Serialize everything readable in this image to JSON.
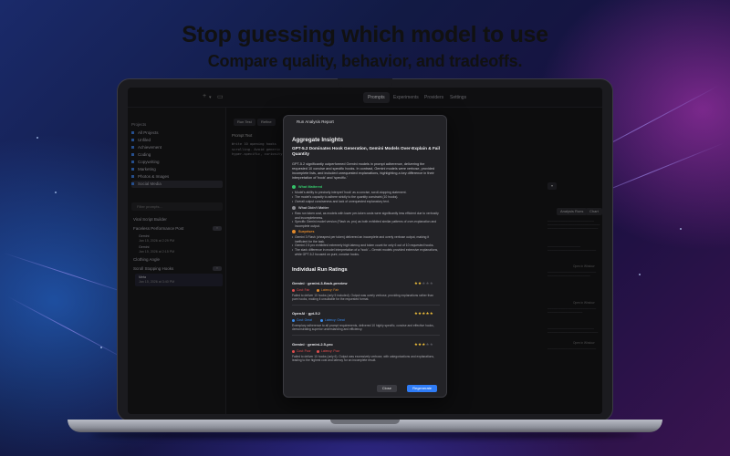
{
  "marketing": {
    "headline": "Stop guessing which model to use",
    "subheadline": "Compare quality, behavior, and tradeoffs."
  },
  "app": {
    "toolbar": {
      "add_icon": "plus-icon",
      "add_label": "+",
      "chevron_icon": "chevron-down-icon",
      "sidebar_toggle_icon": "sidebar-icon"
    },
    "tabs": [
      "Prompts",
      "Experiments",
      "Providers",
      "Settings"
    ],
    "active_tab": "Prompts",
    "sidebar": {
      "section_title": "Projects",
      "projects": [
        {
          "label": "All Projects",
          "count": ""
        },
        {
          "label": "Unfiled",
          "count": ""
        },
        {
          "label": "Achievement",
          "count": ""
        },
        {
          "label": "Coding",
          "count": ""
        },
        {
          "label": "Copywriting",
          "count": ""
        },
        {
          "label": "Marketing",
          "count": ""
        },
        {
          "label": "Photos & Images",
          "count": ""
        },
        {
          "label": "Social Media",
          "count": ""
        }
      ],
      "selected_project": "Social Media",
      "search_placeholder": "Filter prompts...",
      "groups": [
        {
          "label": "Viral Script Builder",
          "pill": ""
        },
        {
          "label": "Faceless Performance Post",
          "pill": ""
        },
        {
          "label": "Gemini",
          "sub": "Jan 15, 2026 at 2:29 PM"
        },
        {
          "label": "Gemini",
          "sub": "Jan 15, 2026 at 2:15 PM"
        },
        {
          "label": "Clothing Angle",
          "pill": ""
        },
        {
          "label": "Scroll Stopping Hooks",
          "pill": ""
        },
        {
          "label": "Meta",
          "sub": "Jan 15, 2026 at 3:40 PM"
        }
      ]
    },
    "editor": {
      "buttons": [
        "Run Test",
        "Refine"
      ],
      "section_label": "Prompt Text",
      "code_lines": [
        "Write 10 opening hooks",
        "scrolling. Avoid generic",
        "hyper-specific, curiosity"
      ]
    },
    "modal": {
      "window_title": "Run Analysis Report",
      "aggregate_title": "Aggregate Insights",
      "headline": "GPT-5.2 Dominates Hook Generation, Gemini Models Over-Explain & Fail Quantity",
      "summary": "GPT-5.2 significantly outperformed Gemini models in prompt adherence, delivering the requested 10 concise and specific hooks. In contrast, Gemini models were verbose, provided incomplete lists, and included unrequested explanations, highlighting a key difference in their interpretation of 'hook' and 'specific.'",
      "sections": [
        {
          "title": "What Mattered",
          "color": "#35c46a",
          "bullets": [
            "Model's ability to precisely interpret 'hook' as a concise, scroll-stopping statement.",
            "The model's capacity to adhere strictly to the quantity constraint (10 hooks).",
            "Overall output conciseness and lack of unrequested explanatory text."
          ]
        },
        {
          "title": "What Didn't Matter",
          "color": "#8a8a90",
          "bullets": [
            "Raw run token cost, as models with lower per-token costs were significantly less efficient due to verbosity and incompleteness.",
            "Specific Gemini model version (Flash vs. pro) as both exhibited similar patterns of over-explanation and incomplete output."
          ]
        },
        {
          "title": "Surprises",
          "color": "#e28a2b",
          "bullets": [
            "Gemini 3 Flash (cheapest per token) delivered an incomplete and overly verbose output, making it inefficient for the task.",
            "Gemini 2.5 pro exhibited extremely high latency and token count for only 6 out of 10 requested hooks.",
            "The stark difference in model interpretation of a 'hook' – Gemini models provided extensive explanations, while GPT-5.2 focused on pure, concise hooks."
          ]
        }
      ],
      "ratings_title": "Individual Run Ratings",
      "runs": [
        {
          "name": "Gemini · gemini-3-flash-preview",
          "stars": 2,
          "tags": [
            {
              "label": "Cost: Fair",
              "color": "#e24d4d"
            },
            {
              "label": "Latency: Fair",
              "color": "#e28a2b"
            }
          ],
          "desc": "Failed to deliver 10 hooks (only 5 included). Output was overly verbose, providing explanations rather than pure hooks, making it unsuitable for the requested format."
        },
        {
          "name": "OpenAI · gpt-5.2",
          "stars": 5,
          "tags": [
            {
              "label": "Cost: Great",
              "color": "#3a8df0"
            },
            {
              "label": "Latency: Great",
              "color": "#3a8df0"
            }
          ],
          "desc": "Exemplary adherence to all prompt requirements, delivered 10 highly specific, concise and effective hooks, demonstrating superior understanding and efficiency."
        },
        {
          "name": "Gemini · gemini-2.5-pro",
          "stars": 3,
          "tags": [
            {
              "label": "Cost: Poor",
              "color": "#e24d4d"
            },
            {
              "label": "Latency: Poor",
              "color": "#e24d4d"
            }
          ],
          "desc": "Failed to deliver 10 hooks (only 6). Output was excessively verbose, with categorizations and explanations, leading to the highest cost and latency for an incomplete result."
        }
      ],
      "close_label": "Close",
      "regenerate_label": "Regenerate"
    },
    "background_panel": {
      "badge_label": "Analysis Runs",
      "badge2": "Chart",
      "open_label": "Open in Window",
      "reply_label": "Reply"
    }
  }
}
